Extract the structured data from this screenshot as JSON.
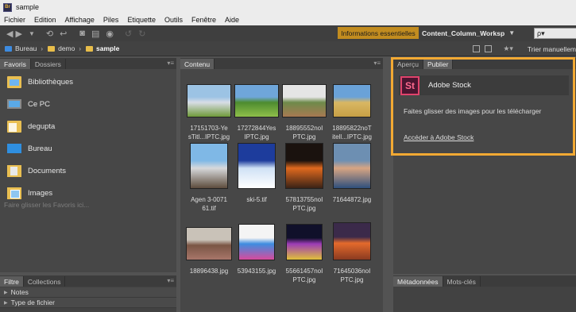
{
  "window": {
    "title": "sample",
    "app_icon_text": "Br"
  },
  "menu": [
    "Fichier",
    "Edition",
    "Affichage",
    "Piles",
    "Etiquette",
    "Outils",
    "Fenêtre",
    "Aide"
  ],
  "toolbar": {
    "workspace_active": "Informations essentielles",
    "workspace_next": "Content_Column_Worksp",
    "search_placeholder": "ρ▾"
  },
  "path": {
    "crumbs": [
      "Bureau",
      "demo",
      "sample"
    ],
    "sort_label": "Trier manuellem"
  },
  "favorites": {
    "tabs": [
      "Favoris",
      "Dossiers"
    ],
    "items": [
      "Bibliothèques",
      "Ce PC",
      "degupta",
      "Bureau",
      "Documents",
      "Images"
    ],
    "drop_hint": "Faire glisser les Favoris ici..."
  },
  "filter": {
    "tabs": [
      "Filtre",
      "Collections"
    ],
    "rows": [
      "Notes",
      "Type de fichier"
    ]
  },
  "content": {
    "tab": "Contenu",
    "thumbnails": [
      {
        "label": "17151703-Ye\nsTitl...IPTC.jpg",
        "colors": [
          "#9cc3e4",
          "#d8dde6",
          "#6f9a3a"
        ]
      },
      {
        "label": "17272844Yes\nIPTC.jpg",
        "colors": [
          "#6fa6da",
          "#4d8c2f",
          "#8fbf4a"
        ]
      },
      {
        "label": "18895552noI\nPTC.jpg",
        "colors": [
          "#e5e5e5",
          "#6e8a4a",
          "#a87a52"
        ]
      },
      {
        "label": "18895822noT\nitell...IPTC.jpg",
        "colors": [
          "#6aa2d8",
          "#d9b763",
          "#c79f45"
        ]
      },
      {
        "label": "Agen 3-0071\n61.tif",
        "colors": [
          "#7fb8e6",
          "#d7d9db",
          "#5d4c3c"
        ]
      },
      {
        "label": "ski-5.tif",
        "colors": [
          "#1d3c9c",
          "#cfe1f5",
          "#ffffff"
        ]
      },
      {
        "label": "57813755noI\nPTC.jpg",
        "colors": [
          "#1a120e",
          "#e0691e",
          "#3a2216"
        ]
      },
      {
        "label": "71644872.jpg",
        "colors": [
          "#6d8fb2",
          "#d8a583",
          "#2e4f7c"
        ]
      },
      {
        "label": "18896438.jpg",
        "colors": [
          "#c9c2b8",
          "#7a5544",
          "#a8766a"
        ]
      },
      {
        "label": "53943155.jpg",
        "colors": [
          "#f4f4f4",
          "#3e8de0",
          "#d84a9c"
        ]
      },
      {
        "label": "55661457noI\nPTC.jpg",
        "colors": [
          "#10102a",
          "#9c3cb6",
          "#e0c03a"
        ]
      },
      {
        "label": "71645036noI\nPTC.jpg",
        "colors": [
          "#3b2a4a",
          "#e46a2c",
          "#8a3a20"
        ]
      }
    ]
  },
  "preview": {
    "tabs": [
      "Aperçu",
      "Publier"
    ],
    "stock_logo": "St",
    "stock_name": "Adobe Stock",
    "stock_desc": "Faites glisser des images pour les télécharger",
    "stock_link": "Accéder à Adobe Stock"
  },
  "metadata": {
    "tabs": [
      "Métadonnées",
      "Mots-clés"
    ]
  },
  "colors": {
    "accent": "#c28c1f",
    "highlight": "#f2a933"
  }
}
